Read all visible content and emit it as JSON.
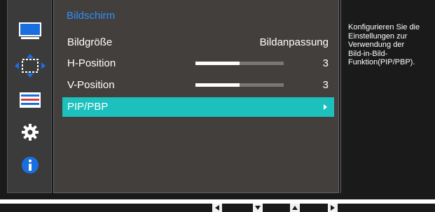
{
  "menu": {
    "title": "Bildschirm",
    "items": [
      {
        "label": "Bildgröße",
        "value": "Bildanpassung"
      },
      {
        "label": "H-Position",
        "value": "3",
        "level": 0.5
      },
      {
        "label": "V-Position",
        "value": "3",
        "level": 0.5
      },
      {
        "label": "PIP/PBP",
        "selected": true
      }
    ]
  },
  "sidebar": {
    "icons": [
      "monitor-icon",
      "move-arrows-icon",
      "color-bars-icon",
      "gear-icon",
      "info-icon"
    ],
    "accent": "#1a6fe0"
  },
  "help": {
    "text": "Konfigurieren Sie die\nEinstellungen zur\nVerwendung der\nBild-in-Bild-\nFunktion(PIP/PBP)."
  },
  "footer": {
    "buttons": [
      "left-arrow-icon",
      "down-arrow-icon",
      "up-arrow-icon",
      "right-arrow-icon"
    ]
  },
  "colors": {
    "title": "#2f8fff",
    "selected_row": "#1cc0bd",
    "panel": "#433f3d"
  }
}
